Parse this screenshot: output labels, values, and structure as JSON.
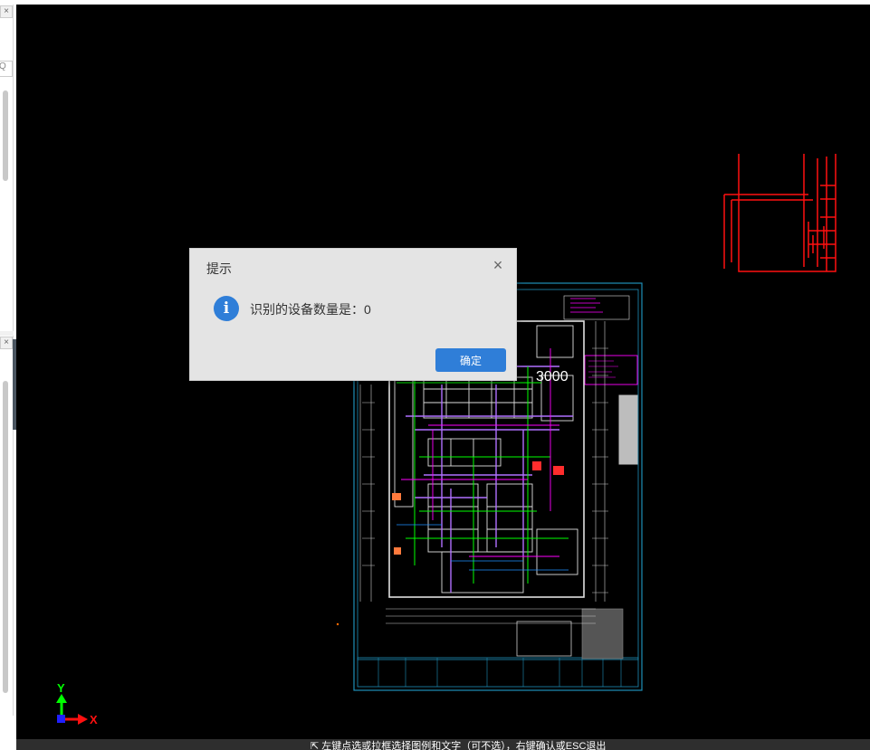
{
  "dialog": {
    "title": "提示",
    "message": "识别的设备数量是：0",
    "ok_label": "确定",
    "close_glyph": "×",
    "icon": "info-icon",
    "info_glyph": "i"
  },
  "left_panels": {
    "close_glyph": "×",
    "search_glyph": "Q"
  },
  "axis": {
    "x_label": "X",
    "y_label": "Y"
  },
  "drawing": {
    "dimension_text": "3000"
  },
  "statusbar": {
    "prompt": "⇱ 左键点选或拉框选择图例和文字（可不选），右键确认或ESC退出"
  },
  "colors": {
    "viewport_bg": "#000000",
    "dialog_bg": "#e4e4e4",
    "accent": "#2f7ed8",
    "cad_frame": "#1e8fb8",
    "cad_red": "#ff1010",
    "cad_magenta": "#ff00ff",
    "cad_green": "#00ff00",
    "cad_purple": "#b070ff"
  }
}
